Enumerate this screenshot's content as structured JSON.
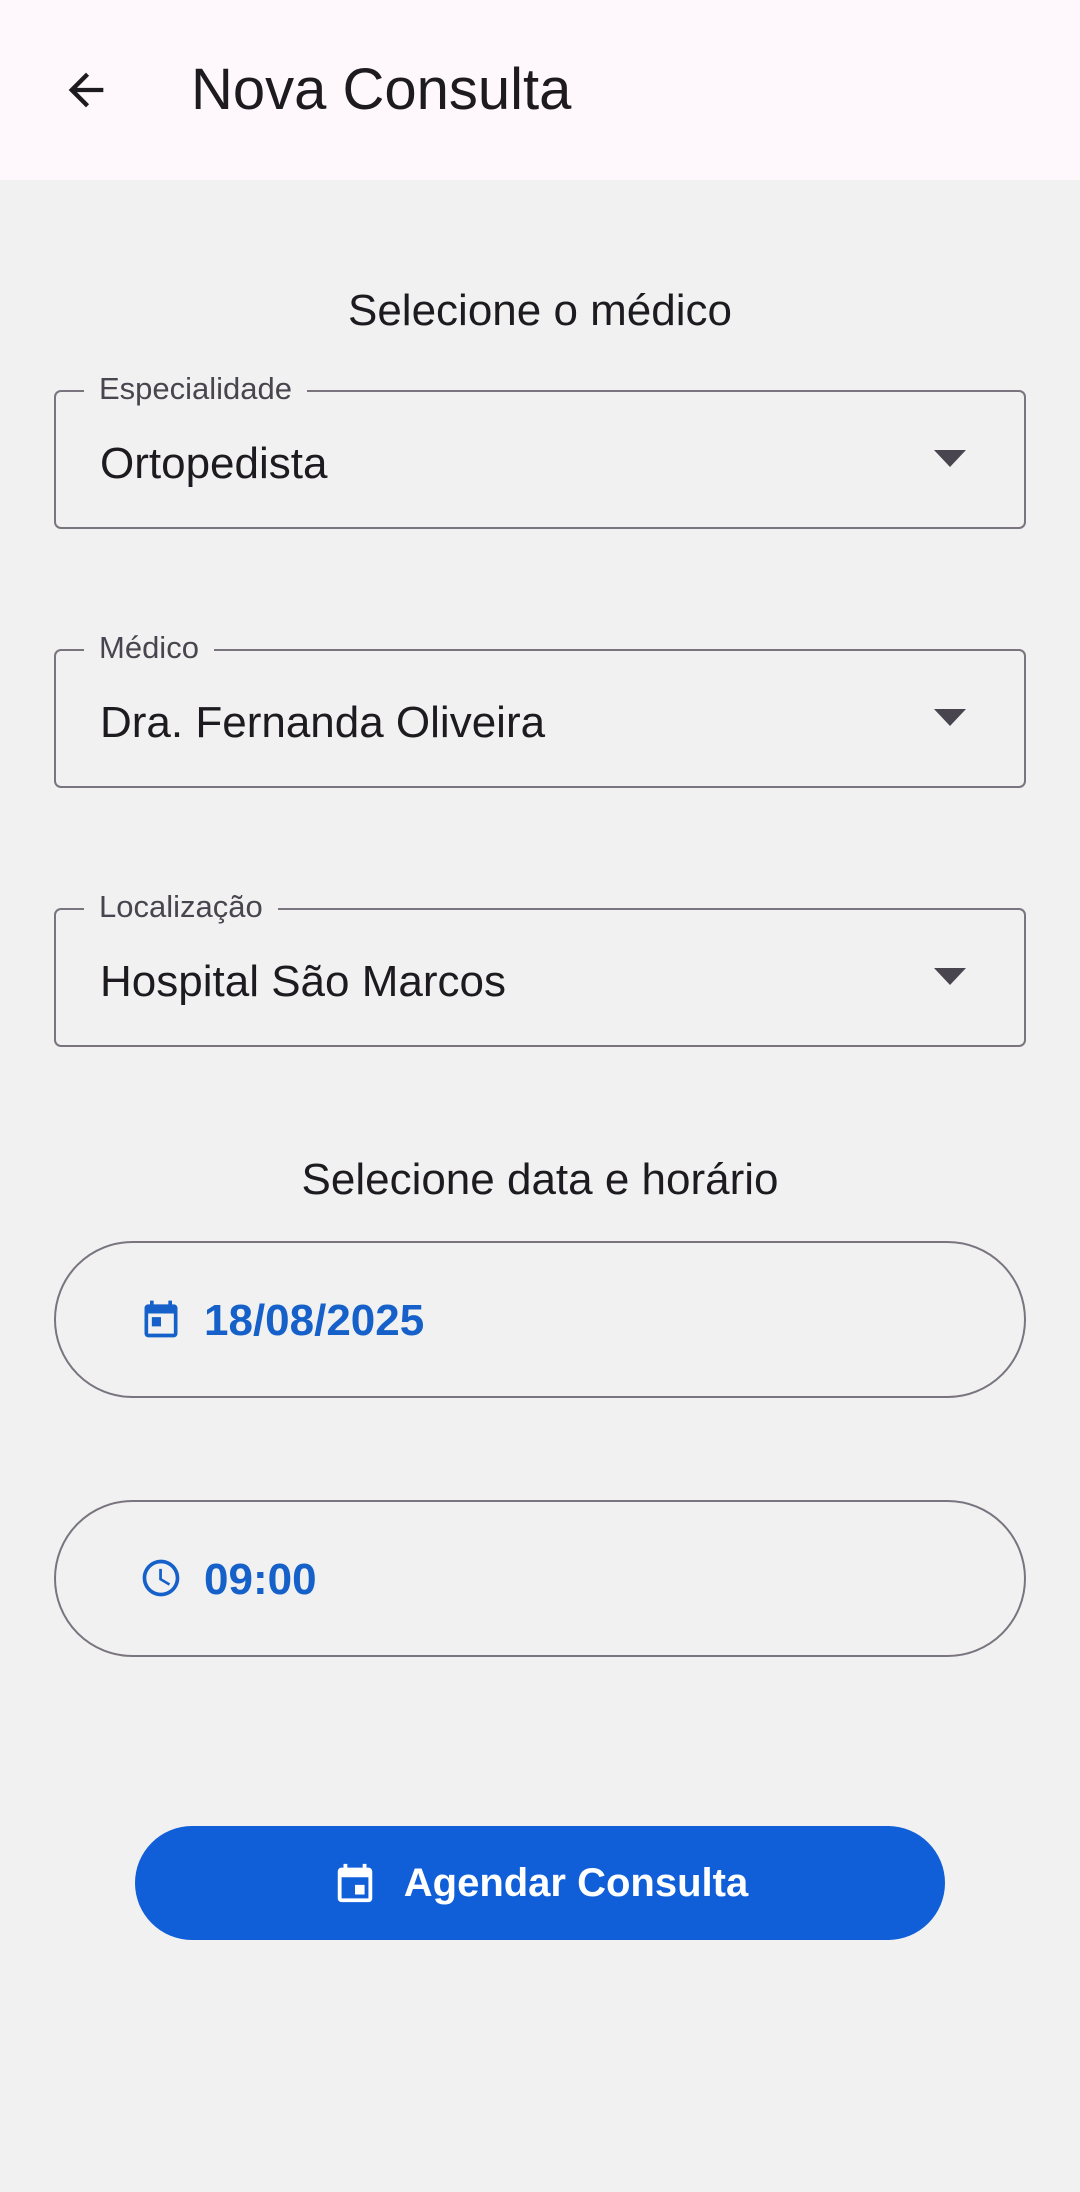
{
  "appbar": {
    "title": "Nova Consulta",
    "back_icon": "arrow-back-icon"
  },
  "doctor_section": {
    "title": "Selecione o médico",
    "specialty": {
      "label": "Especialidade",
      "value": "Ortopedista"
    },
    "doctor": {
      "label": "Médico",
      "value": "Dra. Fernanda Oliveira"
    },
    "location": {
      "label": "Localização",
      "value": "Hospital São Marcos"
    }
  },
  "datetime_section": {
    "title": "Selecione data e horário",
    "date": {
      "value": "18/08/2025",
      "icon": "calendar-icon"
    },
    "time": {
      "value": "09:00",
      "icon": "clock-icon"
    }
  },
  "submit": {
    "label": "Agendar Consulta",
    "icon": "calendar-icon"
  },
  "colors": {
    "appbar_bg": "#fef7fc",
    "page_bg": "#f1f1f1",
    "accent": "#1561c9",
    "button_bg": "#105fd8",
    "outline": "#79747e"
  }
}
